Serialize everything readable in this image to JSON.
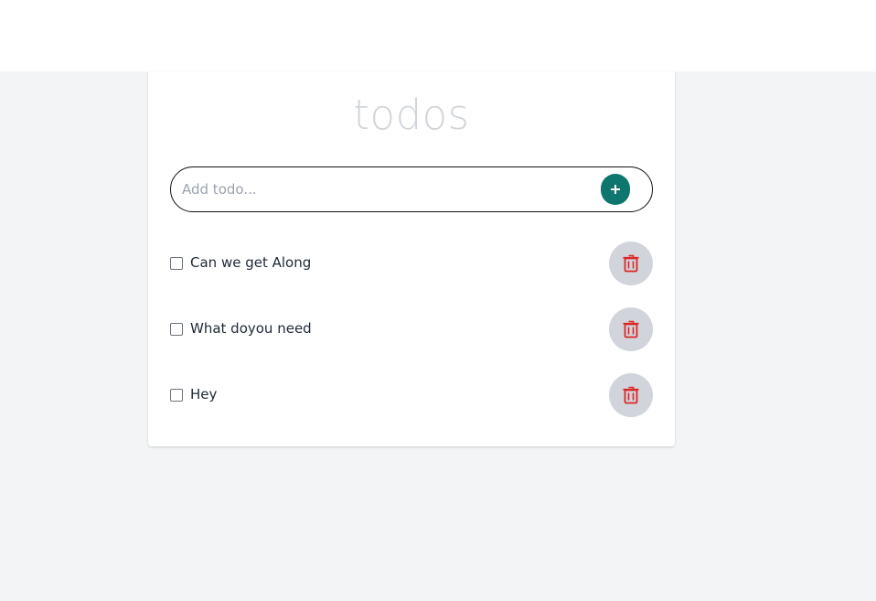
{
  "app": {
    "title": "todos"
  },
  "form": {
    "input_value": "",
    "input_placeholder": "Add todo...",
    "add_button_icon": "plus-icon"
  },
  "todos": [
    {
      "text": "Can we get Along",
      "completed": false,
      "delete_icon": "trash-icon"
    },
    {
      "text": "What doyou need",
      "completed": false,
      "delete_icon": "trash-icon"
    },
    {
      "text": "Hey",
      "completed": false,
      "delete_icon": "trash-icon"
    }
  ],
  "colors": {
    "background": "#f3f4f6",
    "card": "#ffffff",
    "title": "#d1d5db",
    "accent": "#0f766e",
    "delete_bg": "#d1d5db",
    "delete_icon": "#dc2626"
  }
}
